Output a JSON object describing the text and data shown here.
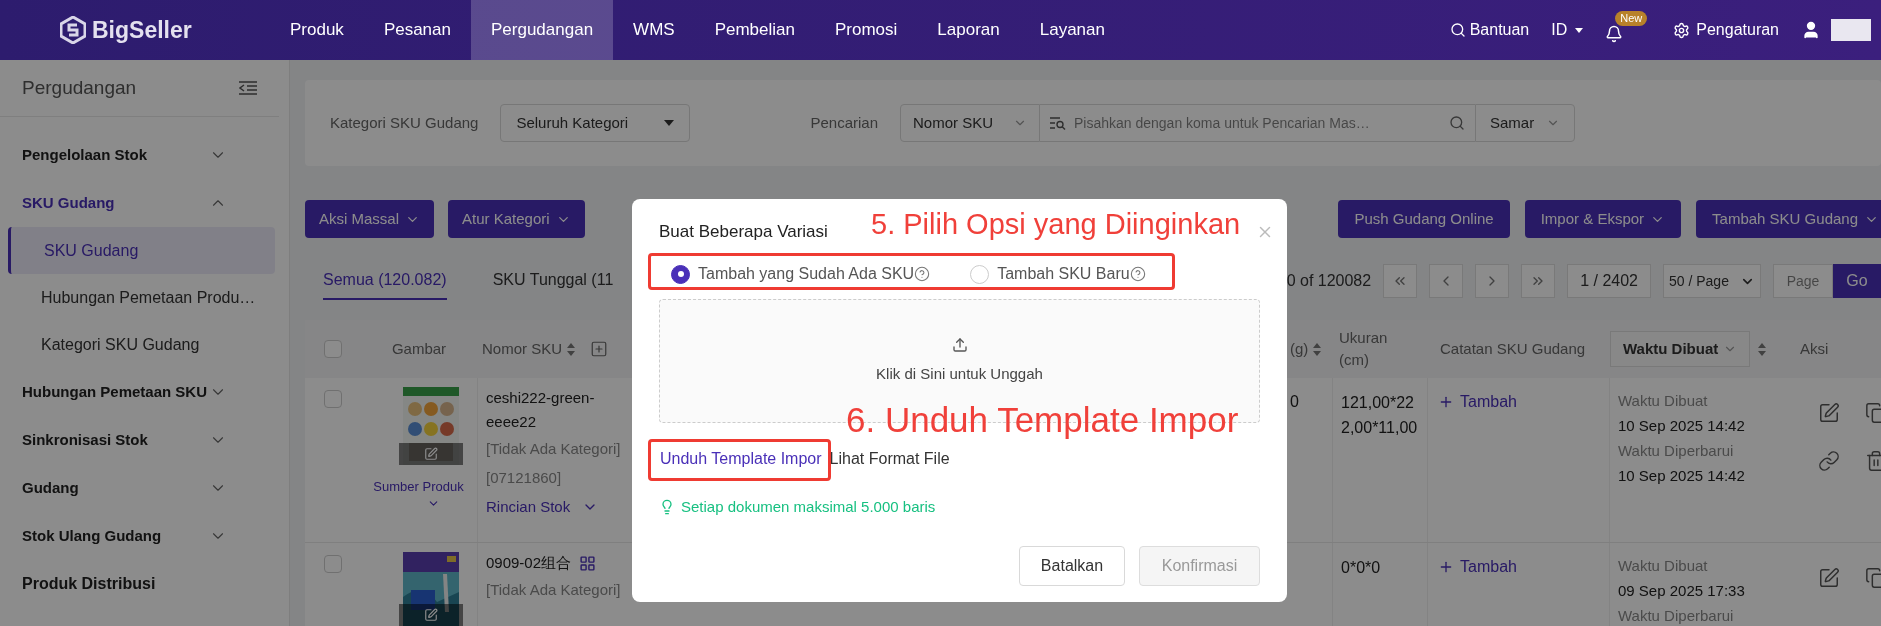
{
  "nav": {
    "logo": "BigSeller",
    "items": [
      {
        "label": "Produk",
        "selected": false
      },
      {
        "label": "Pesanan",
        "selected": false
      },
      {
        "label": "Pergudangan",
        "selected": true
      },
      {
        "label": "WMS",
        "selected": false
      },
      {
        "label": "Pembelian",
        "selected": false
      },
      {
        "label": "Promosi",
        "selected": false
      },
      {
        "label": "Laporan",
        "selected": false
      },
      {
        "label": "Layanan",
        "selected": false
      }
    ],
    "help": "Bantuan",
    "language": "ID",
    "badge": "New",
    "settings": "Pengaturan"
  },
  "sidebar": {
    "title": "Pergudangan",
    "items": [
      {
        "kind": "group",
        "label": "Pengelolaan Stok",
        "expanded": false
      },
      {
        "kind": "group",
        "label": "SKU Gudang",
        "expanded": true,
        "children": [
          {
            "label": "SKU Gudang",
            "selected": true
          },
          {
            "label": "Hubungan Pemetaan Produ…",
            "selected": false
          },
          {
            "label": "Kategori SKU Gudang",
            "selected": false
          }
        ]
      },
      {
        "kind": "group",
        "label": "Hubungan Pemetaan SKU",
        "expanded": false
      },
      {
        "kind": "group",
        "label": "Sinkronisasi Stok",
        "expanded": false
      },
      {
        "kind": "group",
        "label": "Gudang",
        "expanded": false
      },
      {
        "kind": "group",
        "label": "Stok Ulang Gudang",
        "expanded": false
      },
      {
        "kind": "link",
        "label": "Produk Distribusi"
      }
    ]
  },
  "filters": {
    "category_label": "Kategori SKU Gudang",
    "category_value": "Seluruh Kategori",
    "search_label": "Pencarian",
    "search_field": "Nomor SKU",
    "search_placeholder": "Pisahkan dengan koma untuk Pencarian Mas…",
    "match_mode": "Samar"
  },
  "toolbar": {
    "left_buttons": [
      {
        "label": "Aksi Massal",
        "dropdown": true
      },
      {
        "label": "Atur Kategori",
        "dropdown": true
      }
    ],
    "right_buttons": [
      {
        "label": "Push Gudang Online",
        "dropdown": false
      },
      {
        "label": "Impor & Ekspor",
        "dropdown": true
      },
      {
        "label": "Tambah SKU Gudang",
        "dropdown": true
      }
    ]
  },
  "tabs": [
    {
      "label": "Semua (120.082)",
      "selected": true
    },
    {
      "label": "SKU Tunggal (11",
      "selected": false
    }
  ],
  "pagination": {
    "summary": "0 of 120082",
    "page": "1 / 2402",
    "page_size": "50 / Page",
    "jump_placeholder": "Page",
    "go": "Go"
  },
  "table": {
    "header": {
      "checked": false,
      "image": "Gambar",
      "sku": "Nomor SKU",
      "weight": "(g)",
      "size": "Ukuran (cm)",
      "note": "Catatan SKU Gudang",
      "time": "Waktu Dibuat",
      "actions": "Aksi"
    },
    "rows": [
      {
        "checked": false,
        "sku": "ceshi222-green-eeee22",
        "combo": false,
        "category": "[Tidak Ada Kategori]",
        "code": "[07121860]",
        "source_link": "Sumber Produk",
        "stock_link": "Rincian Stok",
        "weight": "0",
        "size": "121,00*222,00*11,00",
        "note_action": "Tambah",
        "created_label": "Waktu Dibuat",
        "created": "10 Sep 2025 14:42",
        "updated_label": "Waktu Diperbarui",
        "updated": "10 Sep 2025 14:42",
        "actions": [
          {
            "kind": "edit"
          },
          {
            "kind": "copy"
          },
          {
            "kind": "link"
          },
          {
            "kind": "delete"
          }
        ]
      },
      {
        "checked": false,
        "sku": "0909-02组合",
        "combo": true,
        "category": "[Tidak Ada Kategori]",
        "size": "0*0*0",
        "note_action": "Tambah",
        "created_label": "Waktu Dibuat",
        "created": "09 Sep 2025 17:33",
        "updated_label": "Waktu Diperbarui",
        "actions": [
          {
            "kind": "edit"
          },
          {
            "kind": "copy"
          }
        ]
      }
    ]
  },
  "modal": {
    "title": "Buat Beberapa Variasi",
    "options": [
      {
        "label": "Tambah yang Sudah Ada SKU",
        "selected": true
      },
      {
        "label": "Tambah SKU Baru",
        "selected": false
      }
    ],
    "upload_text": "Klik di Sini untuk Unggah",
    "template_link": "Unduh Template Impor",
    "format_link": "Lihat Format File",
    "tip": "Setiap dokumen maksimal 5.000 baris",
    "cancel": "Batalkan",
    "confirm": {
      "label": "Konfirmasi",
      "disabled": true
    }
  },
  "annotations": [
    {
      "text": "5. Pilih Opsi yang Diinginkan"
    },
    {
      "text": "6. Unduh Template Impor"
    }
  ]
}
